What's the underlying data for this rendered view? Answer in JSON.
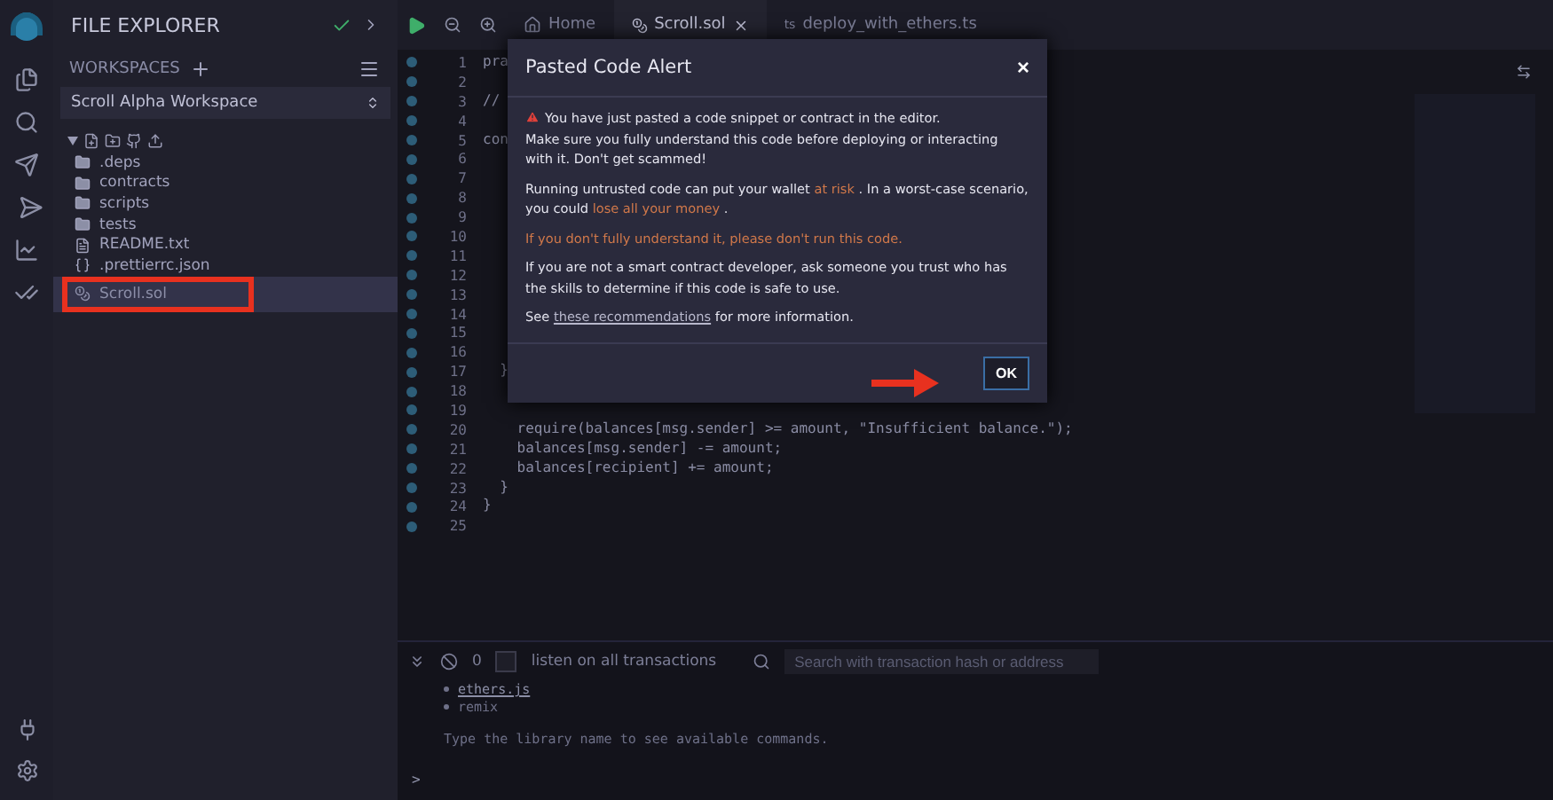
{
  "sidebar": {
    "title": "FILE EXPLORER",
    "workspaces_label": "WORKSPACES",
    "workspace": "Scroll Alpha Workspace",
    "tree": [
      {
        "name": ".deps",
        "kind": "folder",
        "selected": false,
        "highlighted": false
      },
      {
        "name": "contracts",
        "kind": "folder",
        "selected": false,
        "highlighted": false
      },
      {
        "name": "scripts",
        "kind": "folder",
        "selected": false,
        "highlighted": false
      },
      {
        "name": "tests",
        "kind": "folder",
        "selected": false,
        "highlighted": false
      },
      {
        "name": "README.txt",
        "kind": "text",
        "selected": false,
        "highlighted": false
      },
      {
        "name": ".prettierrc.json",
        "kind": "json",
        "selected": false,
        "highlighted": false
      },
      {
        "name": "Scroll.sol",
        "kind": "solidity",
        "selected": true,
        "highlighted": true
      }
    ]
  },
  "tabs": [
    {
      "label": "Home",
      "kind": "home",
      "selected": false
    },
    {
      "label": "Scroll.sol",
      "kind": "solidity",
      "selected": true
    },
    {
      "label": "deploy_with_ethers.ts",
      "kind": "ts",
      "badge": "ts",
      "selected": false
    }
  ],
  "editor": {
    "lines": [
      {
        "number": "1",
        "code": "pra"
      },
      {
        "number": "2"
      },
      {
        "number": "3",
        "code": "//"
      },
      {
        "number": "4"
      },
      {
        "number": "5",
        "code": "con"
      },
      {
        "number": "6"
      },
      {
        "number": "7"
      },
      {
        "number": "8"
      },
      {
        "number": "9"
      },
      {
        "number": "10"
      },
      {
        "number": "11"
      },
      {
        "number": "12"
      },
      {
        "number": "13"
      },
      {
        "number": "14"
      },
      {
        "number": "15"
      },
      {
        "number": "16"
      },
      {
        "number": "17",
        "code": "  }"
      },
      {
        "number": "18"
      },
      {
        "number": "19"
      },
      {
        "number": "20",
        "code": "    require(balances[msg.sender] >= amount, \"Insufficient balance.\");"
      },
      {
        "number": "21",
        "code": "    balances[msg.sender] -= amount;"
      },
      {
        "number": "22",
        "code": "    balances[recipient] += amount;"
      },
      {
        "number": "23",
        "code": "  }"
      },
      {
        "number": "24",
        "code": "}"
      },
      {
        "number": "25"
      }
    ]
  },
  "modal": {
    "title": "Pasted Code Alert",
    "close": "×",
    "paragraphs": [
      {
        "kind": "warning",
        "parts": [
          {
            "text": "You have just pasted a code snippet or contract in the editor.",
            "kind": "plain"
          },
          {
            "text": "Make sure you fully understand this code before deploying or interacting with it. Don't get scammed!",
            "kind": "plain"
          }
        ]
      },
      {
        "kind": "text",
        "parts": [
          {
            "text": "Running untrusted code can put your wallet",
            "kind": "plain"
          },
          {
            "text": "at risk",
            "kind": "alert"
          },
          {
            "text": ". In a worst-case scenario, you could",
            "kind": "plain"
          },
          {
            "text": "lose all your money",
            "kind": "alert"
          },
          {
            "text": ".",
            "kind": "plain"
          }
        ]
      },
      {
        "kind": "text",
        "parts": [
          {
            "text": "If you don't fully understand it, please don't run this code.",
            "kind": "alert"
          }
        ]
      },
      {
        "kind": "text",
        "parts": [
          {
            "text": "If you are not a smart contract developer, ask someone you trust who has the skills to determine if this code is safe to use.",
            "kind": "plain"
          }
        ]
      },
      {
        "kind": "text",
        "parts": [
          {
            "text": "See",
            "kind": "plain"
          },
          {
            "text": "these recommendations",
            "kind": "link"
          },
          {
            "text": "for more information.",
            "kind": "plain"
          }
        ]
      }
    ],
    "button": "OK"
  },
  "terminal": {
    "pending": "0",
    "listen_label": "listen on all transactions",
    "listen_checked": false,
    "search": {
      "placeholder": "Search with transaction hash or address"
    },
    "output": [
      {
        "text": "ethers.js",
        "kind": "link"
      },
      {
        "text": "remix",
        "kind": "item"
      },
      {
        "text": "Type the library name to see available commands.",
        "kind": "note"
      }
    ],
    "prompt": ">"
  }
}
